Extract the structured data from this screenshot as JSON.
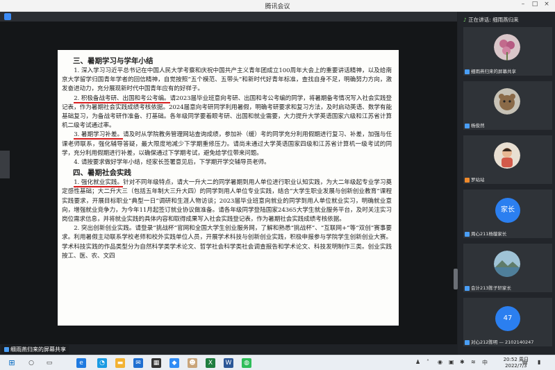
{
  "window": {
    "title": "腾讯会议",
    "controls": [
      "–",
      "□",
      "×"
    ]
  },
  "document": {
    "heading3": "三、暑期学习与学年小结",
    "p1": "1. 深入学习习近平总书记在中国人民大学考察和庆祝中国共产主义青年团成立100周年大会上的重要讲话精神，以及给南京大学留学归国青年学者的回信精神，自觉按照“五个模范、五带头”和新时代好青年标准，查找自身不足，明确努力方向，激发奋进动力，充分展现新时代中国青年应有的好样子。",
    "p2_head": "2. 积极备战考研、出国和考公考编。",
    "p2_body": "请2023届毕业班意向考研、出国和考公考编的同学，将暑期备考情况写入社会实践登记表，作为暑期社会实践成绩考核依据。2024届意向考研同学利用暑假，明确考研要求和复习方法，及时启动英语、数学有能基础复习，为备战考研作准备、打基础。各年级同学要着眼考研、出国和就业需要，大力提升大学英语国家六级和江苏省计算机二级考试通过率。",
    "p3_head": "3. 暑期学习补差。",
    "p3_body": "请及时从学院教务管理网站查询成绩，参加补（缓）考的同学充分利用假期进行复习、补差，加强与任课老师联系，强化辅导答疑，最大限度地减少下学期重修压力。请尚未通过大学英语国家四级和江苏省计算机一级考试的同学，充分利用假期进行补差，以确保通过下学期考试，避免给学位带来问题。",
    "p4": "4. 请按要求做好学年小结，经家长签署意见后，下学期开学交辅导员老师。",
    "heading4": "四、暑期社会实践",
    "p5_head": "1. 强化就业实践。",
    "p5_body": "针对不同年级特点，请大一升大二的同学暑期到用人单位进行职业认知实践，为大二年级起专业学习奠定感性基础；大二升大三（包括五年制大三升大四）的同学到用人单位专业实践，结合“大学生职业发展与创新创业教育”课程实践要求，开展目标职业“典型一日”调研和生涯人物访谈；2023届毕业班意向就业的同学到用人单位就业实习，明确就业意向，增强就业竞争力，为今年11月起签订就业协议做准备。请各年级同学登陆国家24365大学生就业服务平台，及时关注实习岗位需求信息，并将就业实践的具体内容和取得成果写入社会实践登记表，作为暑期社会实践成绩考核依据。",
    "p6_head": "2. 突出创新创业实践。",
    "p6_body": "请登录“挑战杯”官网和全国大学生创业服务网，了解和熟悉“挑战杯”、“互联网+”等“双创”赛事要求。利用暑假主动联系学校老师和校外实践单位人员，开展学术科技与创新创业实践，积极申报参与学院学生创新创业大赛。学术科技实践的作品类型分为自然科学类学术论文、哲学社会科学类社会调查报告和学术论文、科技发明制作三类。创业实践按工、医、农、文四"
  },
  "share_label": "细雨燕归来的屏幕共享",
  "panel": {
    "speaking": "正在讲话: 细雨燕归来",
    "participants": [
      {
        "name": "细雨燕归来的屏幕共享",
        "avatar": "flower"
      },
      {
        "name": "杨俊然",
        "avatar": "bear"
      },
      {
        "name": "罗站站",
        "avatar": "child"
      },
      {
        "name": "周心211杨璇家长",
        "avatar": "text",
        "avatar_text": "家长"
      },
      {
        "name": "会计213陈子轩家长",
        "avatar": "landscape"
      },
      {
        "name": "对心212陈明 — 2102140247",
        "avatar": "text",
        "avatar_text": "47"
      }
    ]
  },
  "taskbar": {
    "time": "20:52 周日",
    "date": "2022/7/3",
    "ime": "中"
  }
}
